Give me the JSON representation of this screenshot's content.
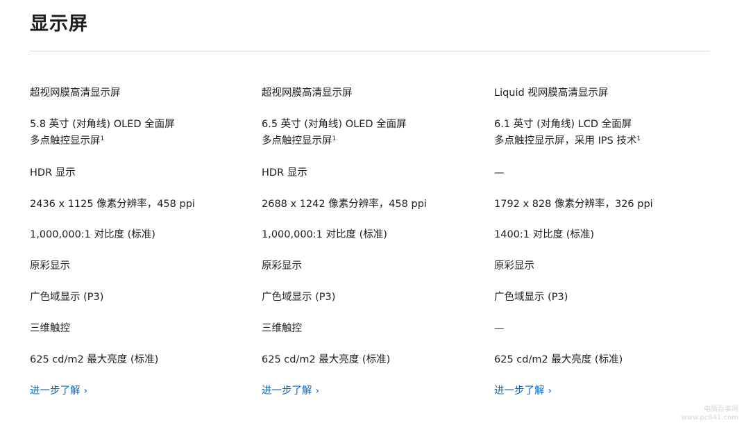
{
  "page": {
    "title": "显示屏"
  },
  "columns": [
    {
      "display_type": "超视网膜高清显示屏",
      "size_line1": "5.8 英寸 (对角线) OLED 全面屏",
      "size_line2": "多点触控显示屏",
      "size_footnote": "1",
      "hdr": "HDR 显示",
      "resolution": "2436 x 1125 像素分辨率，458 ppi",
      "contrast": "1,000,000:1 对比度 (标准)",
      "true_tone": "原彩显示",
      "p3": "广色域显示 (P3)",
      "touch": "三维触控",
      "brightness": "625 cd/m2 最大亮度 (标准)",
      "link": "进一步了解"
    },
    {
      "display_type": "超视网膜高清显示屏",
      "size_line1": "6.5 英寸 (对角线) OLED 全面屏",
      "size_line2": "多点触控显示屏",
      "size_footnote": "1",
      "hdr": "HDR 显示",
      "resolution": "2688 x 1242 像素分辨率，458 ppi",
      "contrast": "1,000,000:1 对比度 (标准)",
      "true_tone": "原彩显示",
      "p3": "广色域显示 (P3)",
      "touch": "三维触控",
      "brightness": "625 cd/m2 最大亮度 (标准)",
      "link": "进一步了解"
    },
    {
      "display_type": "Liquid 视网膜高清显示屏",
      "size_line1": "6.1 英寸 (对角线) LCD 全面屏",
      "size_line2": "多点触控显示屏，采用 IPS 技术",
      "size_footnote": "1",
      "hdr": "—",
      "resolution": "1792 x 828 像素分辨率，326 ppi",
      "contrast": "1400:1 对比度 (标准)",
      "true_tone": "原彩显示",
      "p3": "广色域显示 (P3)",
      "touch": "—",
      "brightness": "625 cd/m2 最大亮度 (标准)",
      "link": "进一步了解"
    }
  ],
  "icons": {
    "link_chevron": "chevron-right-icon"
  },
  "colors": {
    "text": "#1d1d1f",
    "link": "#0066cc",
    "divider": "#d2d2d7"
  },
  "watermark": {
    "line1": "电脑百事网",
    "line2": "www.pc841.com"
  }
}
